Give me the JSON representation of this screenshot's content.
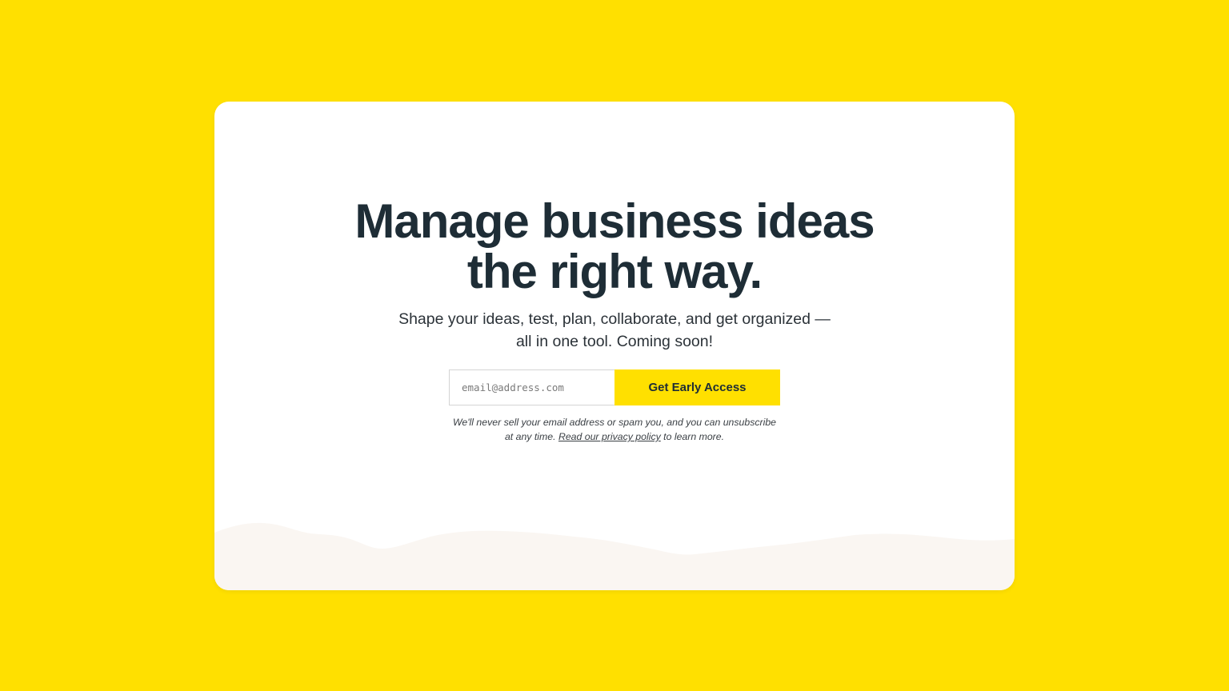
{
  "colors": {
    "background": "#FFE000",
    "card": "#FFFFFF",
    "heading": "#1E2D36",
    "button": "#FFE000",
    "wave": "#FAF6F2"
  },
  "hero": {
    "headline_line1": "Manage business ideas",
    "headline_line2": "the right way.",
    "subhead_line1": "Shape your ideas, test, plan, collaborate, and get organized —",
    "subhead_line2": "all in one tool. Coming soon!"
  },
  "signup": {
    "email_placeholder": "email@address.com",
    "email_value": "",
    "button_label": "Get Early Access"
  },
  "disclaimer": {
    "line1": "We'll never sell your email address or spam you, and you can unsubscribe",
    "line2_prefix": "at any time.",
    "privacy_link": "Read our privacy policy",
    "line2_suffix": "to learn more."
  }
}
